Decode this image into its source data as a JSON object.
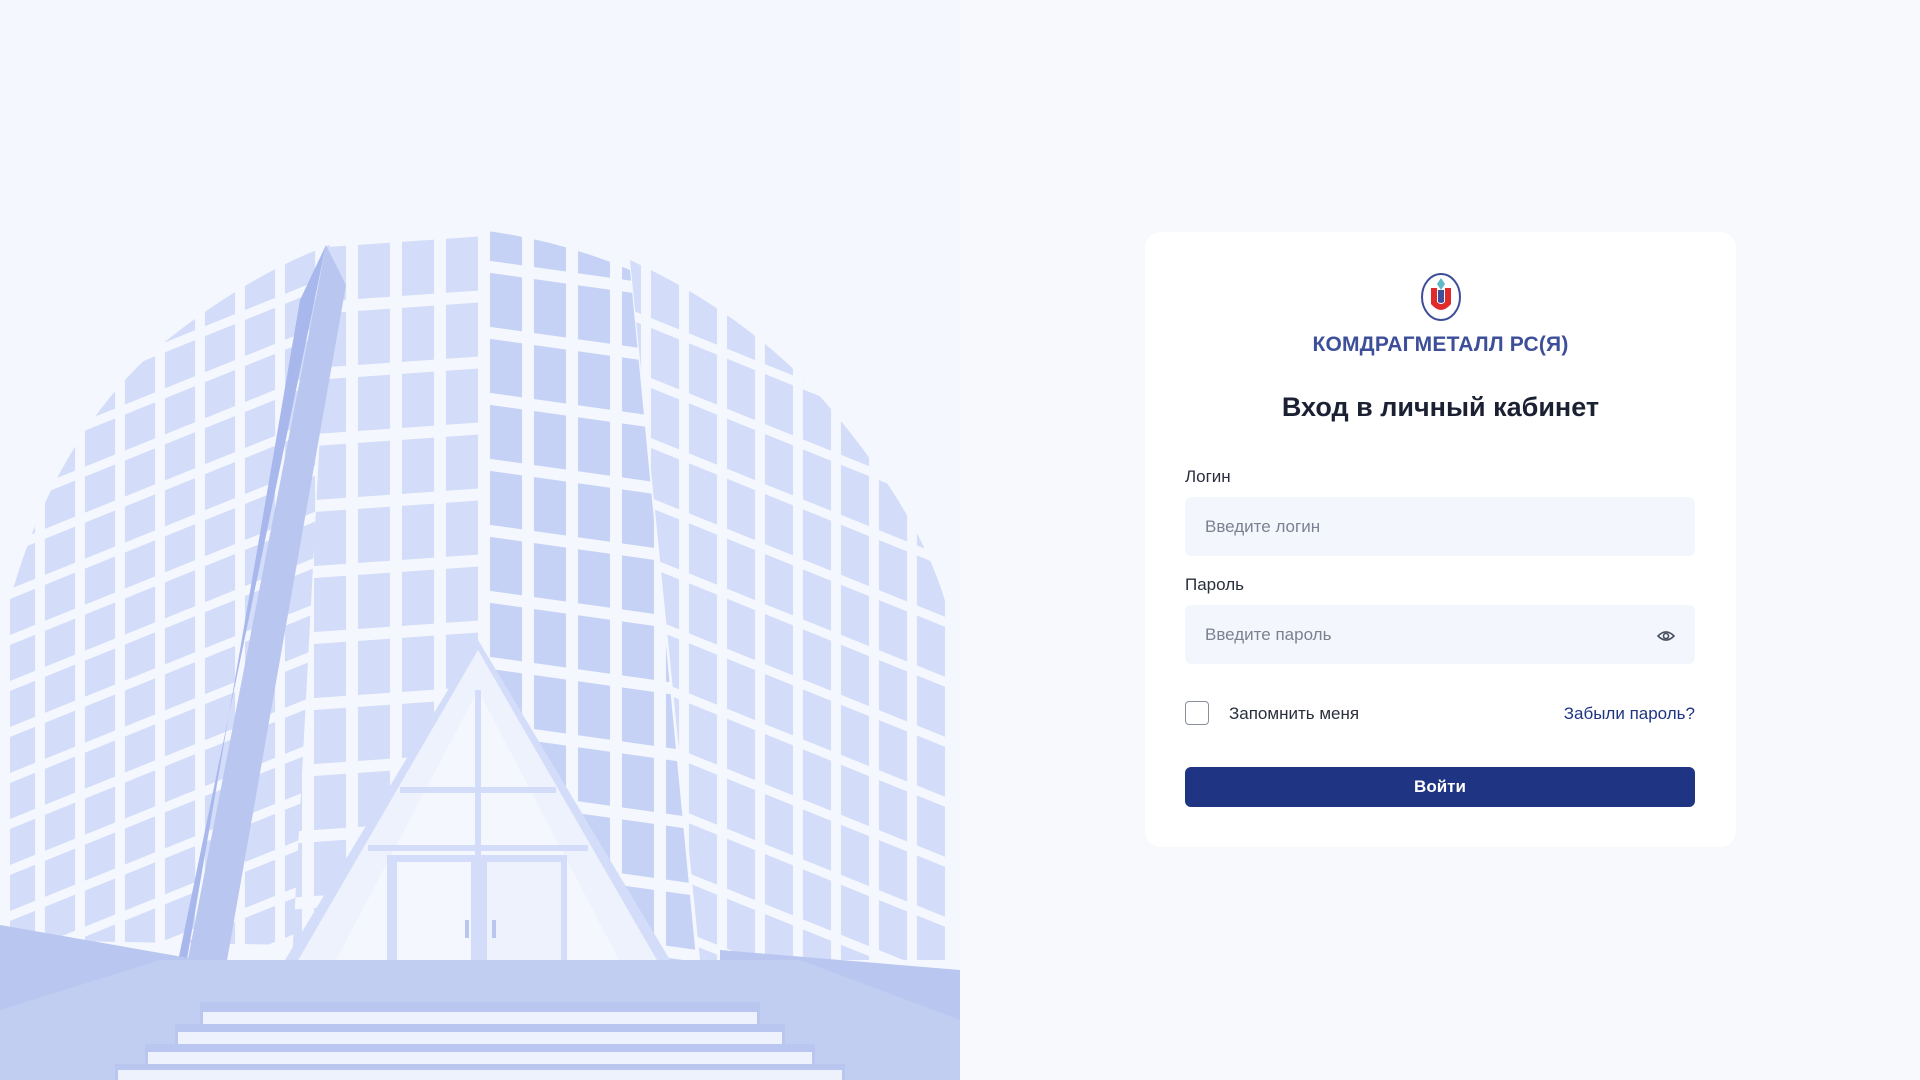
{
  "brand": {
    "name": "КОМДРАГМЕТАЛЛ РС(Я)"
  },
  "login_form": {
    "title": "Вход в личный кабинет",
    "login_label": "Логин",
    "login_placeholder": "Введите логин",
    "login_value": "",
    "password_label": "Пароль",
    "password_placeholder": "Введите пароль",
    "password_value": "",
    "remember_label": "Запомнить меня",
    "remember_checked": false,
    "forgot_link": "Забыли пароль?",
    "submit_label": "Войти"
  },
  "icons": {
    "logo": "shield-emblem-icon",
    "password_toggle": "eye-icon"
  },
  "colors": {
    "primary": "#1f3584",
    "brand_text": "#3e4f99",
    "illustration_light": "#d3dcf8",
    "illustration_dark": "#b9c6f0",
    "page_bg": "#f8f9fc"
  }
}
